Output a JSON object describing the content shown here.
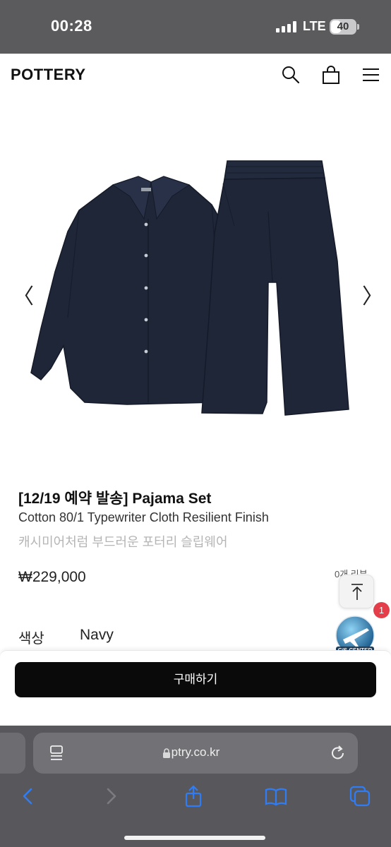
{
  "status_bar": {
    "time": "00:28",
    "network": "LTE",
    "battery": "40",
    "battery_level": 0.4
  },
  "header": {
    "logo": "POTTERY",
    "icons": [
      "search-icon",
      "shopping-bag-icon",
      "menu-icon"
    ]
  },
  "gallery": {
    "prev_arrow": "〈",
    "next_arrow": "〉"
  },
  "product": {
    "title": "[12/19 예약 발송] Pajama Set",
    "subtitle": "Cotton 80/1 Typewriter Cloth Resilient Finish",
    "subtitle_kr": "캐시미어처럼 부드러운 포터리 슬립웨어",
    "price": "₩229,000",
    "review_count": "0개 리뷰",
    "color_label": "색상",
    "color_value": "Navy"
  },
  "cs_center": {
    "label": "C/S CENTER",
    "badge_count": "1"
  },
  "purchase": {
    "buy_label": "구매하기"
  },
  "browser": {
    "url": "ptry.co.kr",
    "toolbar_icons": [
      "back-icon",
      "forward-icon",
      "share-icon",
      "bookmarks-icon",
      "tabs-icon"
    ]
  },
  "colors": {
    "garment_navy": "#1f2638",
    "status_bar_bg": "#5b5b5e",
    "browser_bg": "#58585c",
    "accent_blue": "#2f7df6",
    "buy_button": "#0a0a0a",
    "badge_red": "#e43e4a"
  }
}
